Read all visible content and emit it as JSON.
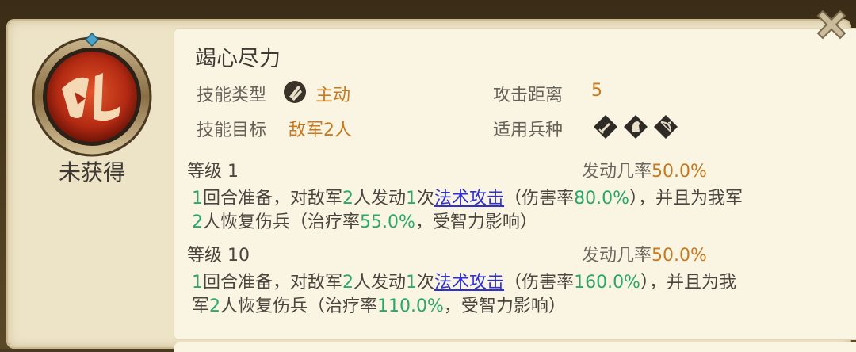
{
  "status_label": "未获得",
  "skill": {
    "name": "竭心尽力",
    "type_label": "技能类型",
    "type_value": "主动",
    "type_icon": "active-skill-icon",
    "range_label": "攻击距离",
    "range_value": "5",
    "target_label": "技能目标",
    "target_value": "敌军2人",
    "troops_label": "适用兵种",
    "troop_icons": [
      "sword-infantry-icon",
      "horse-cavalry-icon",
      "bow-archer-icon"
    ]
  },
  "levels": [
    {
      "level_label": "等级 1",
      "prob_label": "发动几率",
      "prob_value": "50.0%",
      "desc": {
        "prep": "1",
        "t1": "回合准备，对敌军",
        "enemies": "2",
        "t2": "人发动",
        "times": "1",
        "t3": "次",
        "link": "法术攻击",
        "t4": "（伤害率",
        "damage": "80.0%",
        "t5": "），并且为我军",
        "allies": "2",
        "t6": "人恢复伤兵（治疗率",
        "heal": "55.0%",
        "t7": "，受智力影响）"
      }
    },
    {
      "level_label": "等级 10",
      "prob_label": "发动几率",
      "prob_value": "50.0%",
      "desc": {
        "prep": "1",
        "t1": "回合准备，对敌军",
        "enemies": "2",
        "t2": "人发动",
        "times": "1",
        "t3": "次",
        "link": "法术攻击",
        "t4": "（伤害率",
        "damage": "160.0%",
        "t5a": "），并且为我",
        "t5b": "军",
        "allies": "2",
        "t6": "人恢复伤兵（治疗率",
        "heal": "110.0%",
        "t7": "，受智力影响）"
      }
    }
  ],
  "colors": {
    "accent_orange": "#c8781f",
    "value_green": "#29a86b",
    "link_blue": "#2f2fd8",
    "panel_bg": "#ede3c6",
    "card_bg": "#faf5e2"
  }
}
